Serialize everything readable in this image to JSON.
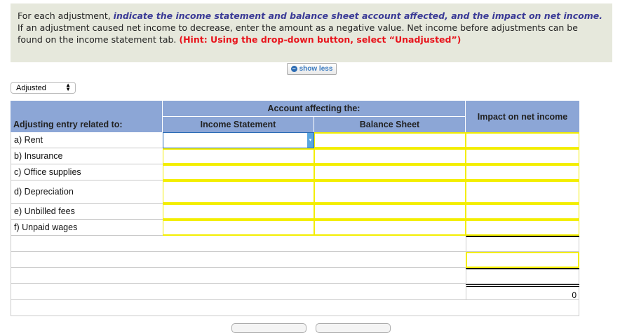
{
  "instructions": {
    "lead": "For each adjustment, ",
    "emphasis": "indicate the income statement and balance sheet account affected, and the impact on net income.",
    "body": "  If an adjustment caused net income to decrease, enter the amount as a negative value.  Net income before adjustments can be found on the income statement tab.  ",
    "hint": "(Hint:  Using the drop-down button, select “Unadjusted”)"
  },
  "show_less_label": "show less",
  "view_select": {
    "selected": "Adjusted"
  },
  "table": {
    "header_group": "Account affecting the:",
    "col_entry": "Adjusting entry related to:",
    "col_income": "Income Statement",
    "col_balance": "Balance Sheet",
    "col_impact": "Impact on net income",
    "rows": [
      {
        "label": "a) Rent"
      },
      {
        "label": "b) Insurance"
      },
      {
        "label": "c) Office supplies"
      },
      {
        "label": "d) Depreciation"
      },
      {
        "label": "e) Unbilled fees"
      },
      {
        "label": "f) Unpaid wages"
      }
    ],
    "total_value": "0"
  }
}
